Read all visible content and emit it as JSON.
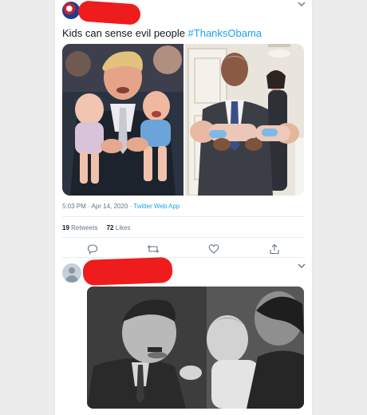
{
  "tweet1": {
    "text_main": "Kids can sense evil people ",
    "hashtag": "#ThanksObama",
    "timestamp": "5:03 PM · Apr 14, 2020 · ",
    "source_app": "Twitter Web App",
    "retweets_count": "19",
    "retweets_label": " Retweets",
    "likes_count": "72",
    "likes_label": " Likes",
    "actions": [
      "reply-icon",
      "retweet-icon",
      "like-icon",
      "share-icon"
    ]
  },
  "colors": {
    "link": "#1da1f2",
    "text": "#14171a",
    "muted": "#657786",
    "redaction": "#ee1c1c"
  }
}
